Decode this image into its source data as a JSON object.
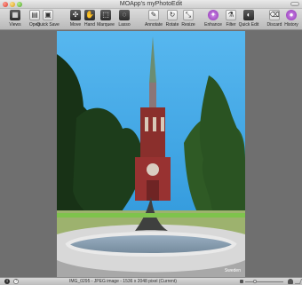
{
  "window": {
    "title": "MOApp's myPhotoEdit"
  },
  "toolbar": {
    "items": [
      {
        "label": "Views",
        "icon": "views-icon"
      },
      {
        "label": "Open",
        "icon": "open-icon"
      },
      {
        "label": "Quick Save",
        "icon": "quick-save-icon"
      },
      {
        "label": "Move",
        "icon": "move-icon"
      },
      {
        "label": "Hand",
        "icon": "hand-icon"
      },
      {
        "label": "Marquee",
        "icon": "marquee-icon"
      },
      {
        "label": "Lasso",
        "icon": "lasso-icon"
      },
      {
        "label": "Annotate",
        "icon": "annotate-icon"
      },
      {
        "label": "Rotate",
        "icon": "rotate-icon"
      },
      {
        "label": "Resize",
        "icon": "resize-icon"
      },
      {
        "label": "Enhance",
        "icon": "enhance-icon"
      },
      {
        "label": "Filter",
        "icon": "filter-icon"
      },
      {
        "label": "Quick Edit",
        "icon": "quick-edit-icon"
      },
      {
        "label": "Discard",
        "icon": "discard-icon"
      },
      {
        "label": "History",
        "icon": "history-icon"
      }
    ]
  },
  "image": {
    "watermark": "Sweden"
  },
  "status": {
    "text": "IMG_0295 - JPEG image - 1536 x 2048 pixel (Current)",
    "zoom_level": 0.2
  },
  "colors": {
    "sky": "#4da9e4",
    "church": "#8c2f2e",
    "tree": "#1f3d18",
    "water": "#8ba5bf",
    "grass": "#6bb33e"
  }
}
